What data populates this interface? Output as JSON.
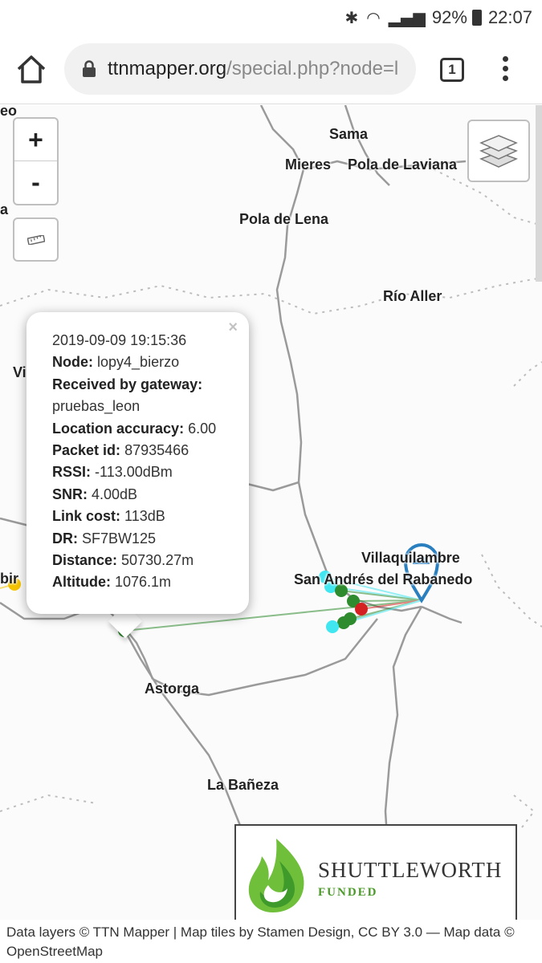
{
  "status_bar": {
    "battery": "92%",
    "time": "22:07"
  },
  "browser": {
    "url_host": "ttnmapper.org",
    "url_path": "/special.php?node=l",
    "tab_count": "1"
  },
  "map": {
    "zoom_in": "+",
    "zoom_out": "-",
    "labels": [
      {
        "text": "Sama"
      },
      {
        "text": "Mieres"
      },
      {
        "text": "Pola de Laviana"
      },
      {
        "text": "Pola de Lena"
      },
      {
        "text": "Río Aller"
      },
      {
        "text": "Villaquilambre"
      },
      {
        "text": "San Andrés del Rabanedo"
      },
      {
        "text": "Astorga"
      },
      {
        "text": "La Bañeza"
      },
      {
        "text": "eo"
      },
      {
        "text": "a"
      },
      {
        "text": "Vi"
      },
      {
        "text": "bir"
      }
    ]
  },
  "popup": {
    "close": "×",
    "timestamp": "2019-09-09 19:15:36",
    "rows": [
      {
        "label": "Node:",
        "value": "lopy4_bierzo"
      },
      {
        "label": "Received by gateway:",
        "value": ""
      },
      {
        "label": "",
        "value": "pruebas_leon"
      },
      {
        "label": "Location accuracy:",
        "value": "6.00"
      },
      {
        "label": "Packet id:",
        "value": "87935466"
      },
      {
        "label": "RSSI:",
        "value": "-113.00dBm"
      },
      {
        "label": "SNR:",
        "value": "4.00dB"
      },
      {
        "label": "Link cost:",
        "value": "113dB"
      },
      {
        "label": "DR:",
        "value": "SF7BW125"
      },
      {
        "label": "Distance:",
        "value": "50730.27m"
      },
      {
        "label": "Altitude:",
        "value": "1076.1m"
      }
    ]
  },
  "sponsor": {
    "title": "SHUTTLEWORTH",
    "subtitle": "FUNDED"
  },
  "attribution": {
    "prefix": "Data layers © TTN Mapper | Map tiles by ",
    "stamen": "Stamen Design",
    "middle": ", ",
    "license": "CC BY 3.0",
    "mapdata": " — Map data © ",
    "osm": "OpenStreetMap"
  },
  "colors": {
    "marker_green": "#2e8b2e",
    "marker_cyan": "#40e6f0",
    "marker_red": "#d42020",
    "marker_yellow": "#f5c400",
    "gateway_pin": "#2a7fbf"
  }
}
